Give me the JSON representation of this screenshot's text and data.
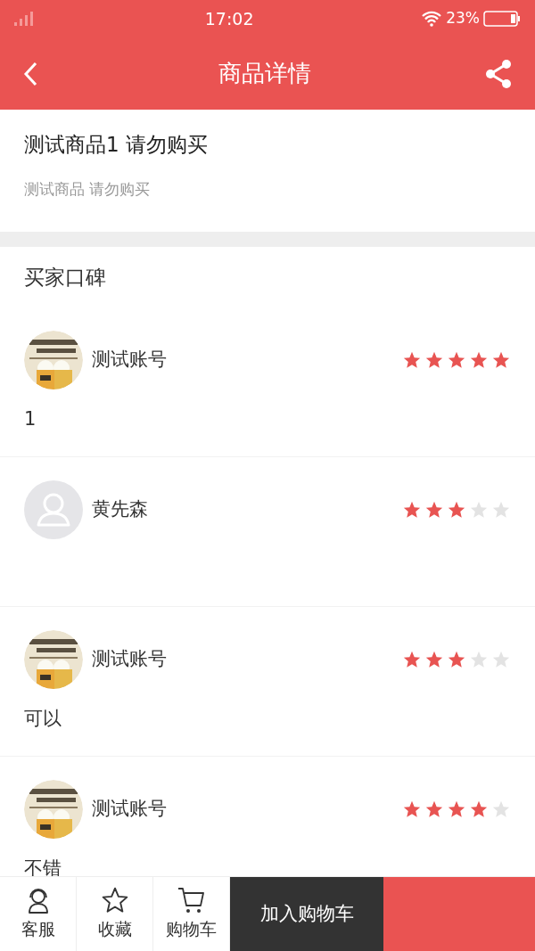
{
  "status_bar": {
    "time": "17:02",
    "battery": "23%"
  },
  "nav": {
    "title": "商品详情"
  },
  "product": {
    "name": "测试商品1 请勿购买",
    "subtitle": "测试商品 请勿购买"
  },
  "reviews_section": {
    "title": "买家口碑"
  },
  "reviews": [
    {
      "user": "测试账号",
      "stars": 5,
      "text": "1"
    },
    {
      "avatar": {
        "kind": "default"
      },
      "user": "黄先森",
      "stars": 3
    },
    {
      "user": "测试账号",
      "stars": 3,
      "text": "可以"
    },
    {
      "user": "测试账号",
      "stars": 4,
      "text": "不错"
    }
  ],
  "bottom_bar": {
    "tabs": [
      {
        "label": "客服",
        "kind": "service"
      },
      {
        "label": "收藏",
        "kind": "favorite"
      },
      {
        "label": "购物车",
        "kind": "cart"
      }
    ],
    "add_to_cart": "加入购物车"
  }
}
